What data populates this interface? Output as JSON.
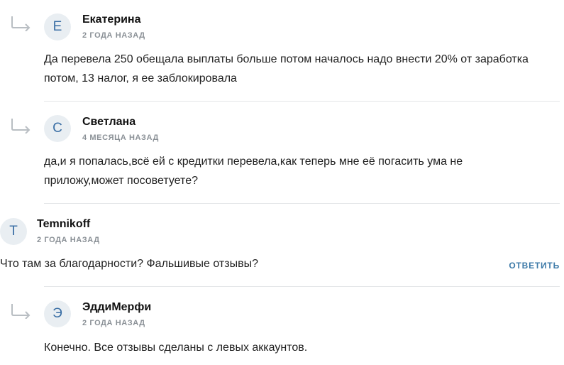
{
  "comments": [
    {
      "avatar_letter": "Е",
      "author": "Екатерина",
      "date": "2 ГОДА НАЗАД",
      "text": "Да перевела 250 обещала выплаты больше потом началось надо внести 20% от заработка потом, 13 налог, я ее заблокировала"
    },
    {
      "avatar_letter": "С",
      "author": "Светлана",
      "date": "4 МЕСЯЦА НАЗАД",
      "text": "да,и я попалась,всё ей с кредитки перевела,как теперь мне её погасить ума не приложу,может посоветуете?"
    },
    {
      "avatar_letter": "T",
      "author": "Temnikoff",
      "date": "2 ГОДА НАЗАД",
      "text": "Что там за благодарности? Фальшивые отзывы?",
      "reply_label": "ОТВЕТИТЬ"
    },
    {
      "avatar_letter": "Э",
      "author": "ЭддиМерфи",
      "date": "2 ГОДА НАЗАД",
      "text": "Конечно. Все отзывы сделаны с левых аккаунтов."
    }
  ]
}
